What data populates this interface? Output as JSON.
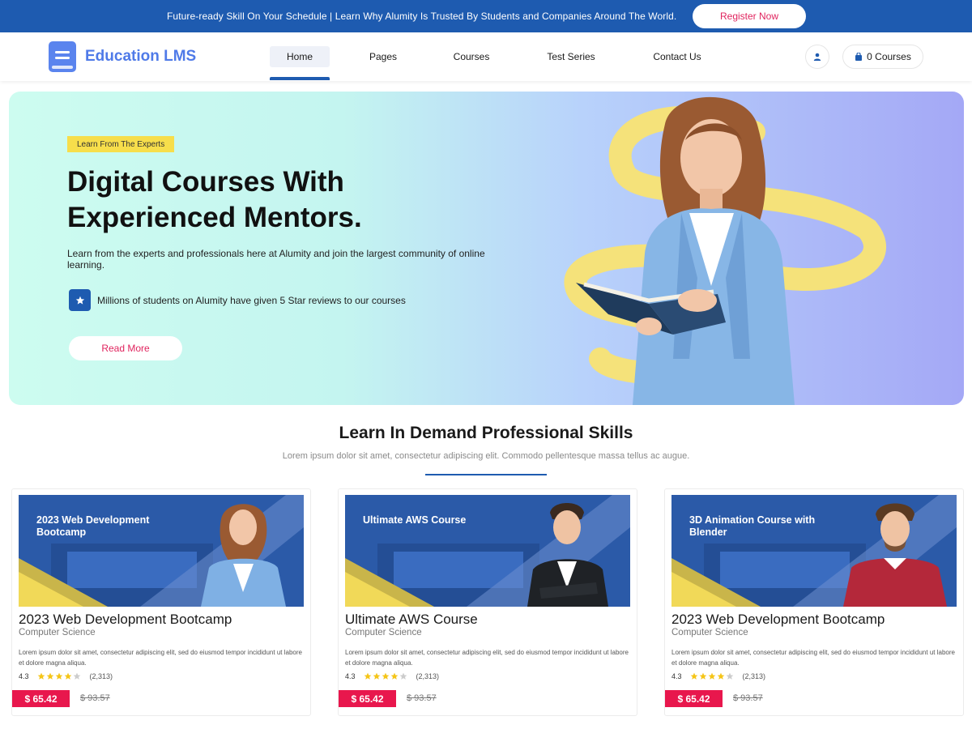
{
  "topbar": {
    "message": "Future-ready Skill On Your Schedule | Learn Why Alumity Is Trusted By Students and Companies Around The World.",
    "register_label": "Register Now"
  },
  "brand": {
    "name": "Education LMS"
  },
  "nav": {
    "home": "Home",
    "pages": "Pages",
    "courses": "Courses",
    "test_series": "Test Series",
    "contact": "Contact Us"
  },
  "cart": {
    "label": "0 Courses"
  },
  "hero": {
    "tag": "Learn From The Experts",
    "title": "Digital Courses With Experienced Mentors.",
    "description": "Learn from the experts and professionals here at Alumity and join the largest community of online learning.",
    "feature": "Millions of students on Alumity have given 5 Star reviews to our courses",
    "cta": "Read More"
  },
  "section": {
    "title": "Learn In Demand Professional Skills",
    "subtitle": "Lorem ipsum dolor sit amet, consectetur adipiscing elit. Commodo pellentesque massa tellus ac augue."
  },
  "courses": [
    {
      "banner": "2023 Web Development Bootcamp",
      "title": "2023 Web Development Bootcamp",
      "category": "Computer Science",
      "description": "Lorem ipsum dolor sit amet, consectetur adipiscing elit, sed do eiusmod tempor incididunt ut labore et dolore magna aliqua.",
      "rating": "4.3",
      "stars": 4,
      "reviews": "(2,313)",
      "price": "$ 65.42",
      "old_price": "$ 93.57"
    },
    {
      "banner": "Ultimate AWS Course",
      "title": "Ultimate AWS Course",
      "category": "Computer Science",
      "description": "Lorem ipsum dolor sit amet, consectetur adipiscing elit, sed do eiusmod tempor incididunt ut labore et dolore magna aliqua.",
      "rating": "4.3",
      "stars": 4,
      "reviews": "(2,313)",
      "price": "$ 65.42",
      "old_price": "$ 93.57"
    },
    {
      "banner": "3D Animation Course with Blender",
      "title": "2023 Web Development Bootcamp",
      "category": "Computer Science",
      "description": "Lorem ipsum dolor sit amet, consectetur adipiscing elit, sed do eiusmod tempor incididunt ut labore et dolore magna aliqua.",
      "rating": "4.3",
      "stars": 4,
      "reviews": "(2,313)",
      "price": "$ 65.42",
      "old_price": "$ 93.57"
    }
  ],
  "colors": {
    "primary": "#1e5bb0",
    "brand": "#4f7ae8",
    "accent": "#e0245e",
    "price": "#e8174d",
    "tag": "#f7de4b",
    "star": "#f5c518"
  },
  "icons": {
    "logo": "book-icon",
    "user": "user-icon",
    "cart": "bag-icon",
    "feature": "star-icon"
  }
}
